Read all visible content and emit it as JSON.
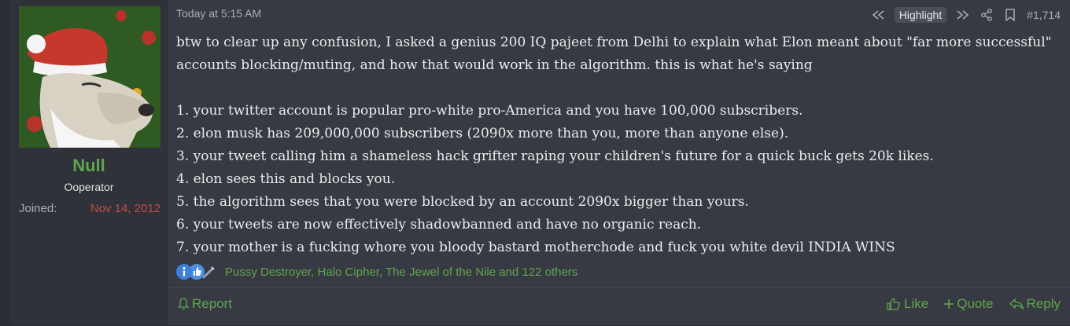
{
  "user": {
    "name": "Null",
    "title": "Ooperator",
    "joined_label": "Joined:",
    "joined_date": "Nov 14, 2012",
    "avatar_icon": "dog-santa-hat-avatar"
  },
  "post": {
    "date": "Today at 5:15 AM",
    "highlight_label": "Highlight",
    "post_number": "#1,714",
    "intro": "btw to clear up any confusion, I asked a genius 200 IQ pajeet from Delhi to explain what Elon meant about \"far more successful\" accounts blocking/muting, and how that would work in the algorithm. this is what he's saying",
    "lines": [
      "1. your twitter account is popular pro-white pro-America and you have 100,000 subscribers.",
      "2. elon musk has 209,000,000 subscribers (2090x more than you, more than anyone else).",
      "3. your tweet calling him a shameless hack grifter raping your children's future for a quick buck gets 20k likes.",
      "4. elon sees this and blocks you.",
      "5. the algorithm sees that you were blocked by an account 2090x bigger than yours.",
      "6. your tweets are now effectively shadowbanned and have no organic reach.",
      "7. your mother is a fucking whore you bloody bastard motherchode and fuck you white devil INDIA WINS"
    ]
  },
  "reactions": {
    "icons": [
      "info-icon",
      "thumbs-up-icon",
      "syringe-icon"
    ],
    "text": "Pussy Destroyer, Halo Cipher, The Jewel of the Nile and 122 others"
  },
  "footer": {
    "report": "Report",
    "like": "Like",
    "quote": "Quote",
    "reply": "Reply"
  },
  "colors": {
    "accent_green": "#5fa54f",
    "joined_red": "#c44a4a",
    "post_bg": "#373a42",
    "sidebar_bg": "#2f3238"
  }
}
